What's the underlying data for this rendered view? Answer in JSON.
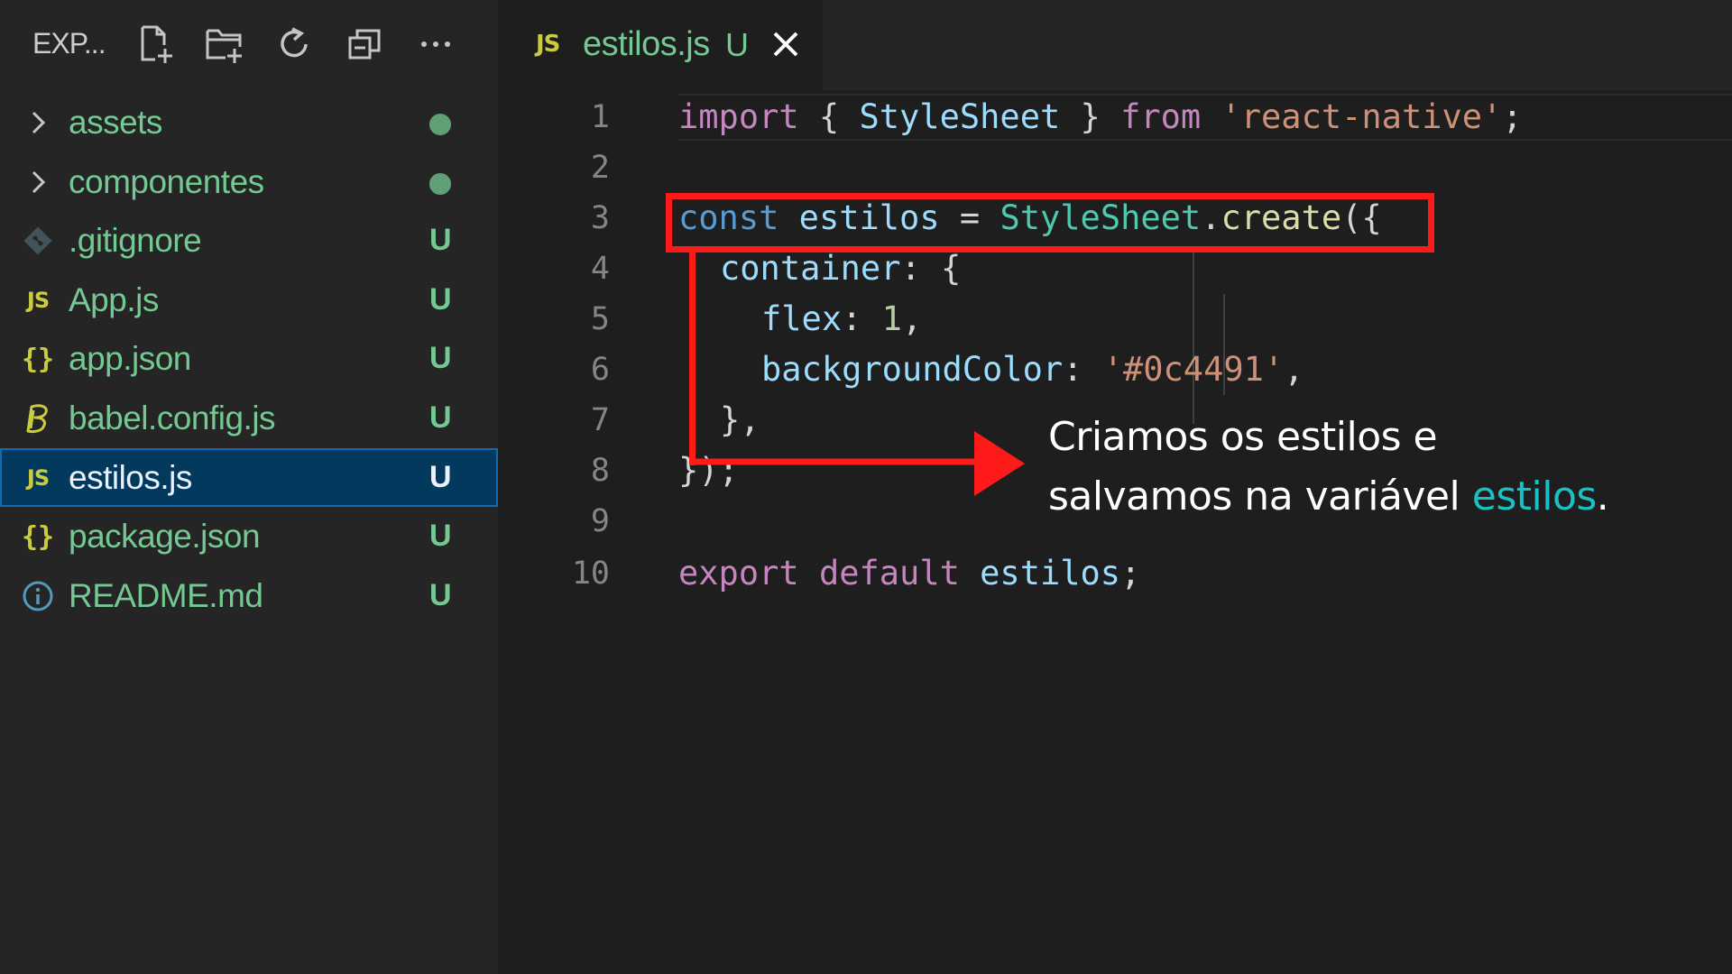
{
  "colors": {
    "sidebar_bg": "#252526",
    "editor_bg": "#1e1e1e",
    "selected_row_bg": "#04395e",
    "untracked_green": "#73c991",
    "js_icon_yellow": "#cbcb41",
    "annotation_red": "#ff1a1a",
    "annotation_accent": "#19c1c4"
  },
  "sidebar": {
    "title": "EXP...",
    "toolbar": [
      {
        "name": "new-file-icon"
      },
      {
        "name": "new-folder-icon"
      },
      {
        "name": "refresh-icon"
      },
      {
        "name": "collapse-all-icon"
      },
      {
        "name": "more-actions-icon",
        "label": "···"
      }
    ],
    "files": [
      {
        "name": "assets",
        "type": "folder",
        "icon": "chevron-right-icon",
        "badge": "",
        "dot": true
      },
      {
        "name": "componentes",
        "type": "folder",
        "icon": "chevron-right-icon",
        "badge": "",
        "dot": true
      },
      {
        "name": ".gitignore",
        "type": "file",
        "icon": "git-icon",
        "badge": "U"
      },
      {
        "name": "App.js",
        "type": "file",
        "icon": "js-icon",
        "icon_text": "JS",
        "badge": "U"
      },
      {
        "name": "app.json",
        "type": "file",
        "icon": "json-icon",
        "icon_text": "{}",
        "badge": "U"
      },
      {
        "name": "babel.config.js",
        "type": "file",
        "icon": "babel-icon",
        "badge": "U"
      },
      {
        "name": "estilos.js",
        "type": "file",
        "icon": "js-icon",
        "icon_text": "JS",
        "badge": "U",
        "selected": true
      },
      {
        "name": "package.json",
        "type": "file",
        "icon": "json-icon",
        "icon_text": "{}",
        "badge": "U"
      },
      {
        "name": "README.md",
        "type": "file",
        "icon": "info-icon",
        "badge": "U"
      }
    ]
  },
  "tab": {
    "icon_text": "JS",
    "label": "estilos.js",
    "badge": "U",
    "close": "close-icon"
  },
  "code": {
    "line_numbers": [
      "1",
      "2",
      "3",
      "4",
      "5",
      "6",
      "7",
      "8",
      "9",
      "10"
    ],
    "l1": {
      "import": "import",
      "open": " { ",
      "cls": "StyleSheet",
      "close": " } ",
      "from": "from",
      "sp": " ",
      "str": "'react-native'",
      "end": ";"
    },
    "l3": {
      "const": "const",
      "sp1": " ",
      "var": "estilos",
      "eq": " = ",
      "cls": "StyleSheet",
      "dot": ".",
      "fn": "create",
      "end": "({"
    },
    "l4": {
      "key": "container",
      "end": ": {"
    },
    "l5": {
      "key": "flex",
      "colon": ": ",
      "num": "1",
      "end": ","
    },
    "l6": {
      "key": "backgroundColor",
      "colon": ": ",
      "str": "'#0c4491'",
      "end": ","
    },
    "l7": {
      "text": "},"
    },
    "l8": {
      "text": "});"
    },
    "l10": {
      "export": "export",
      "sp1": " ",
      "default": "default",
      "sp2": " ",
      "var": "estilos",
      "end": ";"
    }
  },
  "annotation": {
    "line1": "Criamos os estilos e",
    "line2_prefix": "salvamos na variável ",
    "line2_accent": "estilos",
    "line2_suffix": "."
  }
}
